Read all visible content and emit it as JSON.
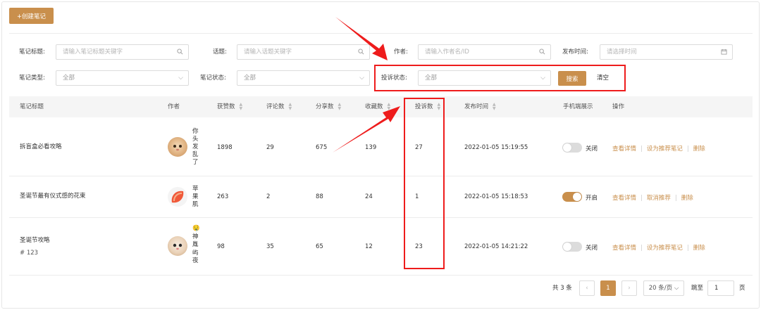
{
  "create_button": "+创建笔记",
  "filters": {
    "title": {
      "label": "笔记标题:",
      "placeholder": "请输入笔记标题关键字"
    },
    "topic": {
      "label": "话题:",
      "placeholder": "请输入话题关键字"
    },
    "author": {
      "label": "作者:",
      "placeholder": "请输入作者名/ID"
    },
    "publish_time": {
      "label": "发布时间:",
      "placeholder": "请选择时间"
    },
    "type": {
      "label": "笔记类型:",
      "value": "全部"
    },
    "status": {
      "label": "笔记状态:",
      "value": "全部"
    },
    "complaint_status": {
      "label": "投诉状态:",
      "value": "全部"
    },
    "search_button": "搜索",
    "clear_button": "清空"
  },
  "table": {
    "headers": [
      "笔记标题",
      "作者",
      "获赞数",
      "评论数",
      "分享数",
      "收藏数",
      "投诉数",
      "发布时间",
      "手机端展示",
      "操作"
    ],
    "rows": [
      {
        "title": "拆盲盒必看攻略",
        "tag": "",
        "author": "你头发乱了",
        "likes": "1898",
        "comments": "29",
        "shares": "675",
        "favorites": "139",
        "complaints": "27",
        "time": "2022-01-05 15:19:55",
        "mobile": "关闭",
        "mobile_on": false,
        "ops": [
          "查看详情",
          "设为推荐笔记",
          "删除"
        ]
      },
      {
        "title": "圣诞节最有仪式感的花束",
        "tag": "",
        "author": "苹果肌",
        "likes": "263",
        "comments": "2",
        "shares": "88",
        "favorites": "24",
        "complaints": "1",
        "time": "2022-01-05 15:18:53",
        "mobile": "开启",
        "mobile_on": true,
        "ops": [
          "查看详情",
          "取消推荐",
          "删除"
        ]
      },
      {
        "title": "圣诞节攻略",
        "tag": "# 123",
        "author": "🤤神胤屿夜",
        "likes": "98",
        "comments": "35",
        "shares": "65",
        "favorites": "12",
        "complaints": "23",
        "time": "2022-01-05 14:21:22",
        "mobile": "关闭",
        "mobile_on": false,
        "ops": [
          "查看详情",
          "设为推荐笔记",
          "删除"
        ]
      }
    ]
  },
  "pagination": {
    "total": "共 3 条",
    "current_page": "1",
    "page_size": "20 条/页",
    "goto_label": "跳至",
    "goto_value": "1",
    "page_unit": "页"
  },
  "colors": {
    "accent": "#c98f4c",
    "highlight": "#ee1c1c"
  }
}
